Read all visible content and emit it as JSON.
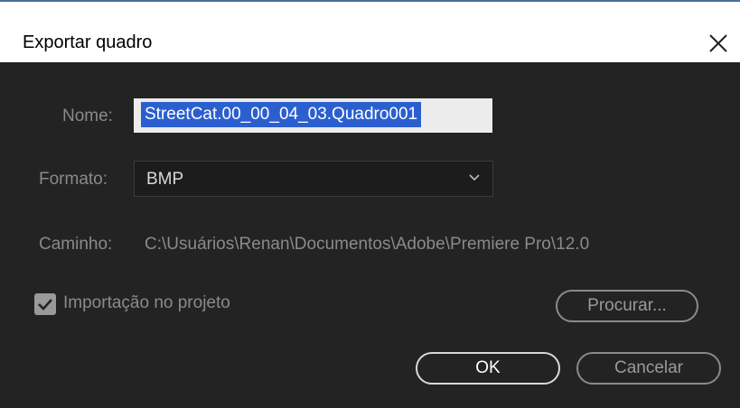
{
  "dialog": {
    "title": "Exportar quadro",
    "close_icon": "close-icon"
  },
  "form": {
    "name_label": "Nome:",
    "name_value": "StreetCat.00_00_04_03.Quadro001",
    "format_label": "Formato:",
    "format_value": "BMP",
    "path_label": "Caminho:",
    "path_value": "C:\\Usuários\\Renan\\Documentos\\Adobe\\Premiere Pro\\12.0",
    "import_label": "Importação no projeto",
    "import_checked": true
  },
  "buttons": {
    "browse": "Procurar...",
    "ok": "OK",
    "cancel": "Cancelar"
  },
  "colors": {
    "background": "#232323",
    "selection": "#2b5fd0"
  }
}
